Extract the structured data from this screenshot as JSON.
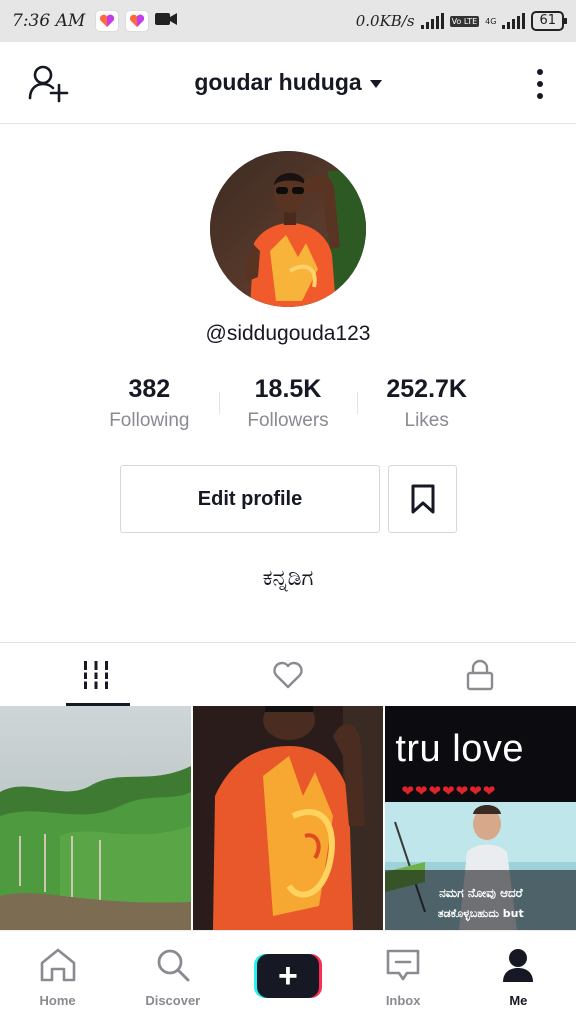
{
  "status_bar": {
    "time": "7:36 AM",
    "network_speed": "0.0KB/s",
    "volte": "Vo LTE",
    "network_type": "4G",
    "battery": "61"
  },
  "header": {
    "title": "goudar huduga",
    "add_friend_icon": "person-add-icon",
    "more_icon": "vertical-dots-icon"
  },
  "profile": {
    "username": "@siddugouda123",
    "bio": "ಕನ್ನಡಿಗ"
  },
  "stats": [
    {
      "value": "382",
      "label": "Following"
    },
    {
      "value": "18.5K",
      "label": "Followers"
    },
    {
      "value": "252.7K",
      "label": "Likes"
    }
  ],
  "actions": {
    "edit_profile": "Edit profile",
    "bookmark_icon": "bookmark-icon"
  },
  "tabs": [
    {
      "icon": "grid-bars-icon",
      "active": true
    },
    {
      "icon": "heart-icon",
      "active": false
    },
    {
      "icon": "lock-icon",
      "active": false
    }
  ],
  "videos": [
    {
      "kind": "vineyard-photo"
    },
    {
      "kind": "person-photo"
    },
    {
      "kind": "text-overlay",
      "title": "tru love",
      "hearts": "❤❤❤❤❤❤❤",
      "caption_line1": "ನಮಗ ನೋವು ಆದರೆ",
      "caption_line2": "ತಡಕೊಳ್ಳಬಹುದು but"
    }
  ],
  "bottom_nav": [
    {
      "label": "Home",
      "icon": "home-icon"
    },
    {
      "label": "Discover",
      "icon": "search-icon"
    },
    {
      "label": "",
      "icon": "plus-icon"
    },
    {
      "label": "Inbox",
      "icon": "inbox-icon"
    },
    {
      "label": "Me",
      "icon": "person-icon",
      "active": true
    }
  ],
  "colors": {
    "text": "#161823",
    "muted": "#8a8b91",
    "divider": "#e3e3e4",
    "brand_cyan": "#25f4ee",
    "brand_red": "#fe2c55"
  }
}
